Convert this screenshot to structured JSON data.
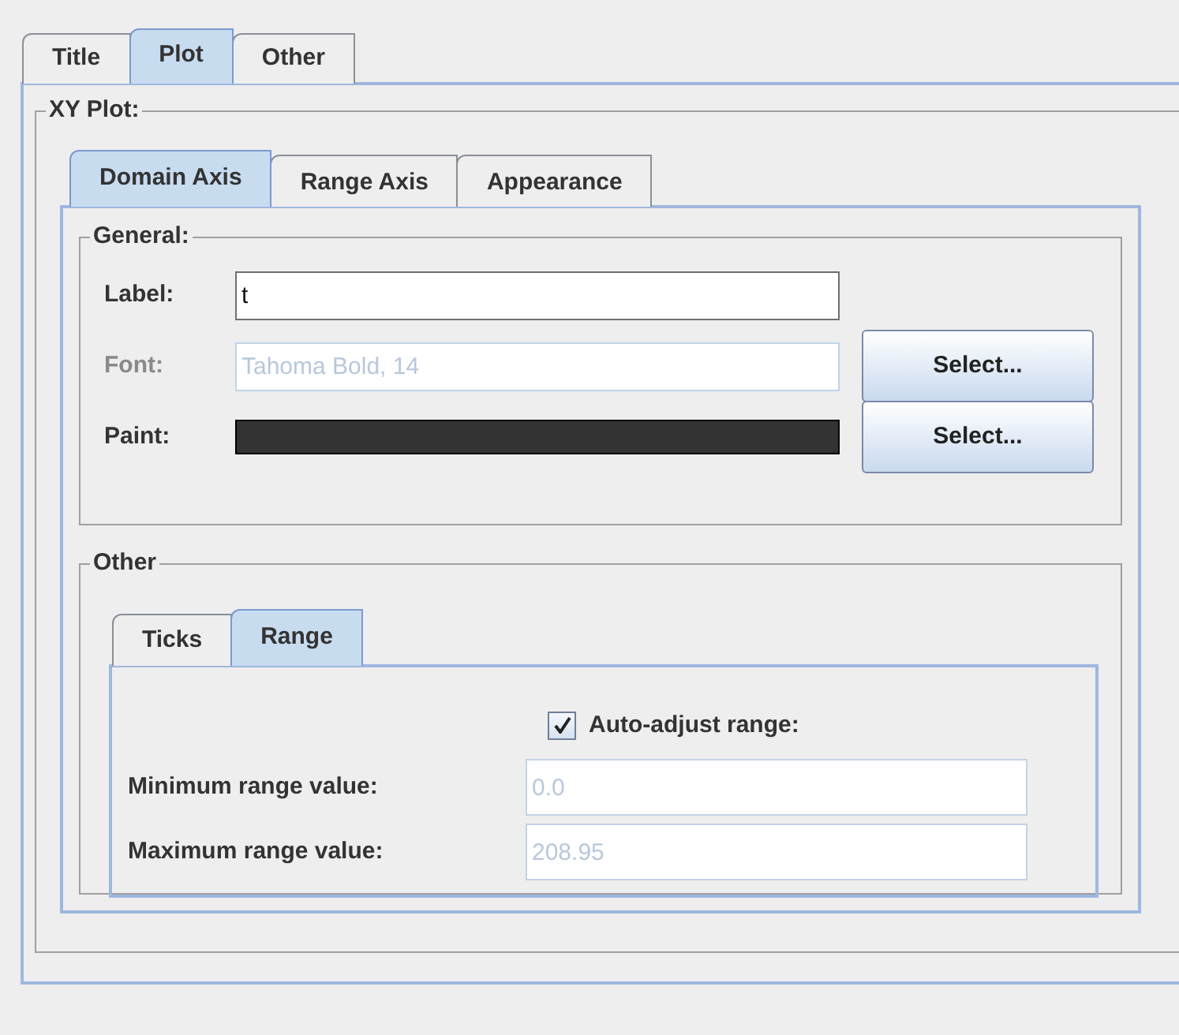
{
  "tabs": [
    {
      "label": "Title",
      "selected": false
    },
    {
      "label": "Plot",
      "selected": true
    },
    {
      "label": "Other",
      "selected": false
    }
  ],
  "xy_plot": {
    "title": "XY Plot:",
    "tabs": [
      {
        "label": "Domain Axis",
        "selected": true
      },
      {
        "label": "Range Axis",
        "selected": false
      },
      {
        "label": "Appearance",
        "selected": false
      }
    ],
    "general": {
      "title": "General:",
      "rows": [
        {
          "kind": "text",
          "label": "Label:",
          "value": "t",
          "disabled": false
        },
        {
          "kind": "text",
          "label": "Font:",
          "value": "Tahoma Bold, 14",
          "disabled": true,
          "button": "Select..."
        },
        {
          "kind": "paint",
          "label": "Paint:",
          "color": "#333333",
          "disabled": false,
          "button": "Select..."
        }
      ]
    },
    "other": {
      "title": "Other",
      "tabs": [
        {
          "label": "Ticks",
          "selected": false
        },
        {
          "label": "Range",
          "selected": true
        }
      ],
      "auto_adjust": {
        "label": "Auto-adjust range:",
        "checked": true
      },
      "fields": [
        {
          "label": "Minimum range value:",
          "value": "0.0",
          "disabled": true
        },
        {
          "label": "Maximum range value:",
          "value": "208.95",
          "disabled": true
        }
      ]
    }
  }
}
